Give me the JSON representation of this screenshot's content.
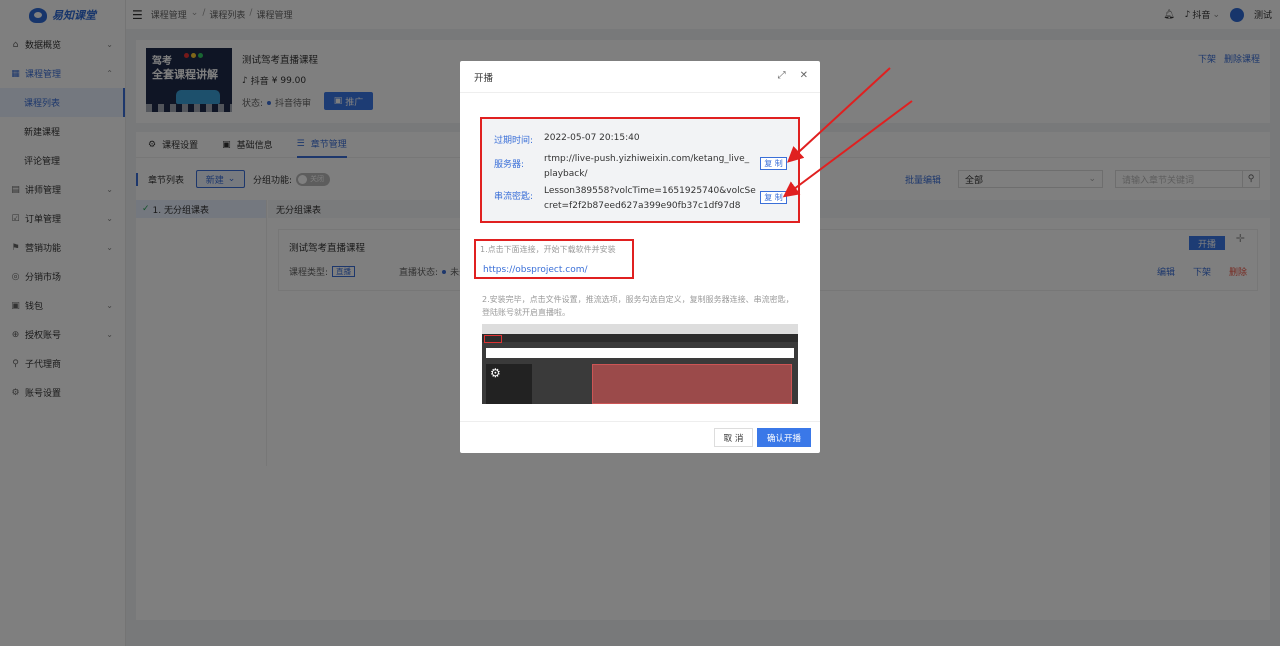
{
  "brand": {
    "name": "易知课堂"
  },
  "sidebar": {
    "items": [
      {
        "label": "数据概览",
        "icon": "home-icon",
        "chevron": "⌄"
      },
      {
        "label": "课程管理",
        "icon": "grid-icon",
        "chevron": "⌃",
        "active": true
      },
      {
        "label": "讲师管理",
        "icon": "teacher-icon",
        "chevron": "⌄"
      },
      {
        "label": "订单管理",
        "icon": "order-icon",
        "chevron": "⌄"
      },
      {
        "label": "营销功能",
        "icon": "marketing-icon",
        "chevron": "⌄"
      },
      {
        "label": "分销市场",
        "icon": "market-icon",
        "chevron": ""
      },
      {
        "label": "钱包",
        "icon": "wallet-icon",
        "chevron": "⌄"
      },
      {
        "label": "授权账号",
        "icon": "auth-icon",
        "chevron": "⌄"
      },
      {
        "label": "子代理商",
        "icon": "agent-icon",
        "chevron": ""
      },
      {
        "label": "账号设置",
        "icon": "settings-icon",
        "chevron": ""
      }
    ],
    "sub_items": [
      "课程列表",
      "新建课程",
      "评论管理"
    ]
  },
  "topbar": {
    "breadcrumb": [
      "课程管理",
      "课程列表",
      "课程管理"
    ],
    "platform": "抖音",
    "user": "测试"
  },
  "course": {
    "cover_line1": "驾考",
    "cover_line2": "全套课程讲解",
    "title": "测试驾考直播课程",
    "platform": "抖音",
    "price": "¥ 99.00",
    "status_label": "状态:",
    "status_value": "抖音待审",
    "promote_label": "推广",
    "link_offline": "下架",
    "link_delete": "删除课程"
  },
  "tabs": [
    {
      "label": "课程设置",
      "icon": "gear-icon"
    },
    {
      "label": "基础信息",
      "icon": "info-icon"
    },
    {
      "label": "章节管理",
      "icon": "list-icon",
      "active": true
    }
  ],
  "toolbar": {
    "list_label": "章节列表",
    "new_label": "新建",
    "group_label": "分组功能:",
    "toggle_label": "关闭",
    "batch_label": "批量编辑",
    "filter_value": "全部",
    "search_placeholder": "请输入章节关键词"
  },
  "tree": {
    "item": "1. 无分组课表"
  },
  "chapter": {
    "head": "无分组课表",
    "title": "测试驾考直播课程",
    "type_label": "课程类型:",
    "type_value": "直播",
    "status_label": "直播状态:",
    "status_value": "未开播",
    "start_label": "开播",
    "edit": "编辑",
    "offline": "下架",
    "delete": "删除"
  },
  "modal": {
    "title": "开播",
    "expire_label": "过期时间:",
    "expire_value": "2022-05-07 20:15:40",
    "server_label": "服务器:",
    "server_value_line1": "rtmp://live-push.yizhiweixin.com/ketang_live_",
    "server_value_line2": "playback/",
    "key_label": "串流密匙:",
    "key_value_line1": "Lesson389558?volcTime=1651925740&volcSe",
    "key_value_line2": "cret=f2f2b87eed627a399e90fb37c1df97d8",
    "copy_label": "复 制",
    "step1": "1.点击下面连接，开始下载软件并安装",
    "link": "https://obsproject.com/",
    "step2": "2.安装完毕，点击文件设置，推流选项，服务勾选自定义，复制服务器连接、串流密匙，登陆账号就开启直播啦。",
    "cancel_label": "取 消",
    "confirm_label": "确认开播"
  },
  "colors": {
    "accent": "#3a78e8",
    "highlight": "#e02020"
  }
}
